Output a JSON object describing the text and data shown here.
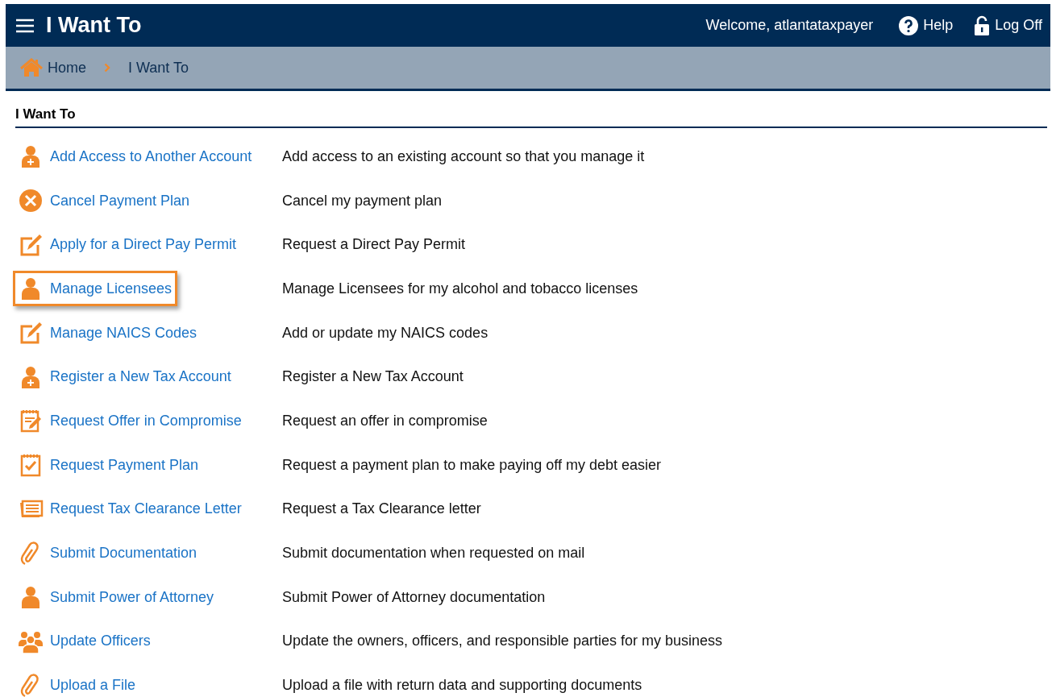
{
  "header": {
    "title": "I Want To",
    "welcome": "Welcome, atlantataxpayer",
    "help": "Help",
    "logoff": "Log Off"
  },
  "breadcrumb": [
    "Home",
    "I Want To"
  ],
  "section": {
    "title": "I Want To"
  },
  "items": [
    {
      "kind": "person-add",
      "label": "Add Access to Another Account",
      "description": "Add access to an existing account so that you manage it",
      "highlighted": false
    },
    {
      "kind": "cancel",
      "label": "Cancel Payment Plan",
      "description": "Cancel my payment plan",
      "highlighted": false
    },
    {
      "kind": "edit",
      "label": "Apply for a Direct Pay Permit",
      "description": "Request a Direct Pay Permit",
      "highlighted": false
    },
    {
      "kind": "person",
      "label": "Manage Licensees",
      "description": "Manage Licensees for my alcohol and tobacco licenses",
      "highlighted": true
    },
    {
      "kind": "edit",
      "label": "Manage NAICS Codes",
      "description": "Add or update my NAICS codes",
      "highlighted": false
    },
    {
      "kind": "person-add",
      "label": "Register a New Tax Account",
      "description": "Register a New Tax Account",
      "highlighted": false
    },
    {
      "kind": "notepad-edit",
      "label": "Request Offer in Compromise",
      "description": "Request an offer in compromise",
      "highlighted": false
    },
    {
      "kind": "notepad-check",
      "label": "Request Payment Plan",
      "description": "Request a payment plan to make paying off my debt easier",
      "highlighted": false
    },
    {
      "kind": "letter",
      "label": "Request Tax Clearance Letter",
      "description": "Request a Tax Clearance letter",
      "highlighted": false
    },
    {
      "kind": "clip",
      "label": "Submit Documentation",
      "description": "Submit documentation when requested on mail",
      "highlighted": false
    },
    {
      "kind": "person",
      "label": "Submit Power of Attorney",
      "description": "Submit Power of Attorney documentation",
      "highlighted": false
    },
    {
      "kind": "people",
      "label": "Update Officers",
      "description": "Update the owners, officers, and responsible parties for my business",
      "highlighted": false
    },
    {
      "kind": "clip",
      "label": "Upload a File",
      "description": "Upload a file with return data and supporting documents",
      "highlighted": false
    }
  ]
}
